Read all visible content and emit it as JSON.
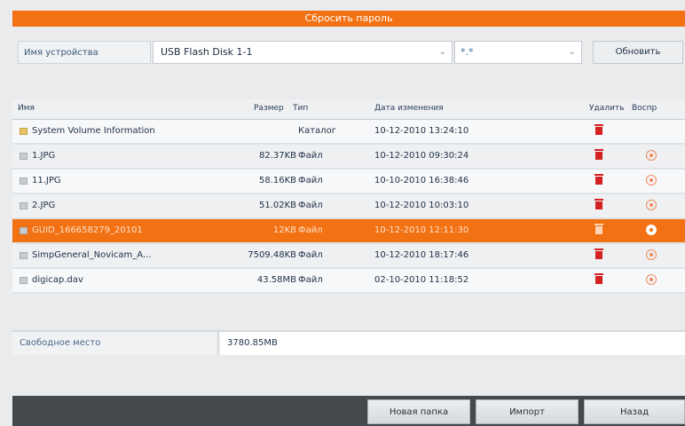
{
  "title": "Сбросить пароль",
  "device": {
    "label": "Имя устройства",
    "selected": "USB Flash Disk 1-1",
    "filter": "*.*",
    "refresh_label": "Обновить"
  },
  "table": {
    "headers": {
      "name": "Имя",
      "size": "Размер",
      "type": "Тип",
      "date": "Дата изменения",
      "delete": "Удалить",
      "play": "Воспр"
    },
    "rows": [
      {
        "name": "System Volume Information",
        "size": "",
        "type": "Каталог",
        "date": "10-12-2010 13:24:10",
        "icon": "folder-icon",
        "play": false
      },
      {
        "name": "1.JPG",
        "size": "82.37KB",
        "type": "Файл",
        "date": "10-12-2010 09:30:24",
        "icon": "file-icon",
        "play": true
      },
      {
        "name": "11.JPG",
        "size": "58.16KB",
        "type": "Файл",
        "date": "10-10-2010 16:38:46",
        "icon": "file-icon",
        "play": true
      },
      {
        "name": "2.JPG",
        "size": "51.02KB",
        "type": "Файл",
        "date": "10-12-2010 10:03:10",
        "icon": "file-icon",
        "play": true
      },
      {
        "name": "GUID_166658279_20101",
        "size": "12KB",
        "type": "Файл",
        "date": "10-12-2010 12:11:30",
        "icon": "file-icon",
        "play": true,
        "selected": true
      },
      {
        "name": "SimpGeneral_Novicam_A...",
        "size": "7509.48KB",
        "type": "Файл",
        "date": "10-12-2010 18:17:46",
        "icon": "file-icon",
        "play": true
      },
      {
        "name": "digicap.dav",
        "size": "43.58MB",
        "type": "Файл",
        "date": "02-10-2010 11:18:52",
        "icon": "file-icon",
        "play": true
      }
    ]
  },
  "free_space": {
    "label": "Свободное место",
    "value": "3780.85MB"
  },
  "footer": {
    "new_folder": "Новая папка",
    "import": "Импорт",
    "back": "Назад"
  },
  "colors": {
    "accent": "#f27113",
    "delete": "#d42121",
    "footer_bg": "#45484c"
  }
}
